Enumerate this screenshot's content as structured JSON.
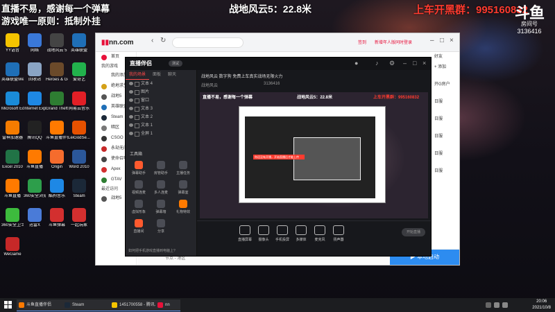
{
  "overlay": {
    "line1": "直播不易，感谢每一个弹幕",
    "line2": "游戏唯一原则：抵制外挂",
    "game_title": "战地风云5：22.8米",
    "group_text": "上车开黑群：995160832",
    "logo_main": "斗鱼",
    "logo_sub": "房间号",
    "room_id": "3136416"
  },
  "desktop_icons": [
    {
      "label": "YY语音",
      "color": "#f5c400"
    },
    {
      "label": "网络",
      "color": "#3a78d8"
    },
    {
      "label": "战地风云 5",
      "color": "#444"
    },
    {
      "label": "英雄联盟",
      "color": "#1f6fb7"
    },
    {
      "label": "英雄联盟WeGame版",
      "color": "#1f6fb7"
    },
    {
      "label": "回收站",
      "color": "#8aa4c4"
    },
    {
      "label": "Heroes & Generals",
      "color": "#6b4a2a"
    },
    {
      "label": "爱奇艺",
      "color": "#22b14c"
    },
    {
      "label": "Microsoft Edge",
      "color": "#1a8bd8"
    },
    {
      "label": "Internet Explorer",
      "color": "#1e88e5"
    },
    {
      "label": "Grand Theft Auto V",
      "color": "#2e7d32"
    },
    {
      "label": "网易云音乐",
      "color": "#e21f26"
    },
    {
      "label": "雷神加速器",
      "color": "#f57c00"
    },
    {
      "label": "腾讯QQ",
      "color": "#222"
    },
    {
      "label": "斗鱼直播伴侣",
      "color": "#ff7a00"
    },
    {
      "label": "LeiGodSe...",
      "color": "#e65100"
    },
    {
      "label": "Excel 2010",
      "color": "#217346"
    },
    {
      "label": "斗鱼直播",
      "color": "#ff7a00"
    },
    {
      "label": "Origin",
      "color": "#f56c2d"
    },
    {
      "label": "Word 2010",
      "color": "#2b579a"
    },
    {
      "label": "斗鱼直播",
      "color": "#ff7a00"
    },
    {
      "label": "360安全浏览器",
      "color": "#2d9e4b"
    },
    {
      "label": "酷狗音乐",
      "color": "#1e88e5"
    },
    {
      "label": "Steam",
      "color": "#1b2838"
    },
    {
      "label": "360安全卫士",
      "color": "#3dbb3d"
    },
    {
      "label": "迅雷X",
      "color": "#4a7bd8"
    },
    {
      "label": "斗鱼弹幕",
      "color": "#d32f2f"
    },
    {
      "label": "一起玩家",
      "color": "#d32f2f"
    },
    {
      "label": "WeGame",
      "color": "#c62828"
    }
  ],
  "browser": {
    "logo_prefix": "",
    "logo_rest": "nn.com",
    "url_text": "",
    "act1": "签到",
    "act2": "新增年人版同时登录",
    "sidebar_head1": "我的游戏",
    "sidebar_head2": "最近访问",
    "sidebar_items": [
      {
        "label": "首页",
        "color": "#e8113a"
      },
      {
        "label": "我的添加",
        "color": "#fff"
      },
      {
        "label": "绝地求生",
        "color": "#d4a017"
      },
      {
        "label": "战地5",
        "color": "#555"
      },
      {
        "label": "英雄联盟",
        "color": "#1f6fb7"
      },
      {
        "label": "Steam",
        "color": "#1b2838"
      },
      {
        "label": "暗区",
        "color": "#777"
      },
      {
        "label": "CSGO",
        "color": "#333"
      },
      {
        "label": "永劫无间",
        "color": "#c62828"
      },
      {
        "label": "使命召唤",
        "color": "#444"
      },
      {
        "label": "Apex",
        "color": "#d32f2f"
      },
      {
        "label": "GTAV",
        "color": "#2e7d32"
      },
      {
        "label": "战地5",
        "color": "#555"
      }
    ],
    "right_items": [
      "好友",
      "+ 添加",
      "开G房户",
      "日服",
      "日服",
      "日服",
      "日服",
      "日服"
    ],
    "bottom_text": "节点 - 港区",
    "start_label": "本地启动"
  },
  "app": {
    "logo": "直播伴侣",
    "version": "测试",
    "tabs": [
      "我的场景",
      "面板",
      "聊天"
    ],
    "scenes": [
      "文本 4",
      "图片",
      "窗口",
      "文本 3",
      "文本 2",
      "文本 1",
      "全屏 1"
    ],
    "tools_title": "工具箱",
    "tools": [
      "弹幕助手",
      "房管助手",
      "主播任务",
      "视频连麦",
      "多人连麦",
      "弹幕室",
      "虚拟形象",
      "弹幕墙",
      "礼物特效",
      "直播间",
      "分享"
    ],
    "notice": "如何把手机游戏直播到电脑上?",
    "stream_title": "战地风云 数字狗 免费上车真实战场无限火力",
    "stream_category": "战地风云",
    "stream_stats": "3136416",
    "controls": [
      "直播屏幕",
      "摄像头",
      "手机投屏",
      "多媒体",
      "麦克风",
      "扬声器"
    ],
    "go_label": "开始直播"
  },
  "nested": {
    "title": "战地风云5：22.8米",
    "banner": "你还没有开播，开始直播后才能上传"
  },
  "taskbar": {
    "items": [
      {
        "label": "斗鱼直播伴侣",
        "color": "#ff7a00"
      },
      {
        "label": "Steam",
        "color": "#1b2838"
      },
      {
        "label": "1451700558 - 腾讯...",
        "color": "#f5c400"
      },
      {
        "label": "nn",
        "color": "#e8113a"
      }
    ],
    "time": "20:06",
    "date": "2021/10/8"
  }
}
